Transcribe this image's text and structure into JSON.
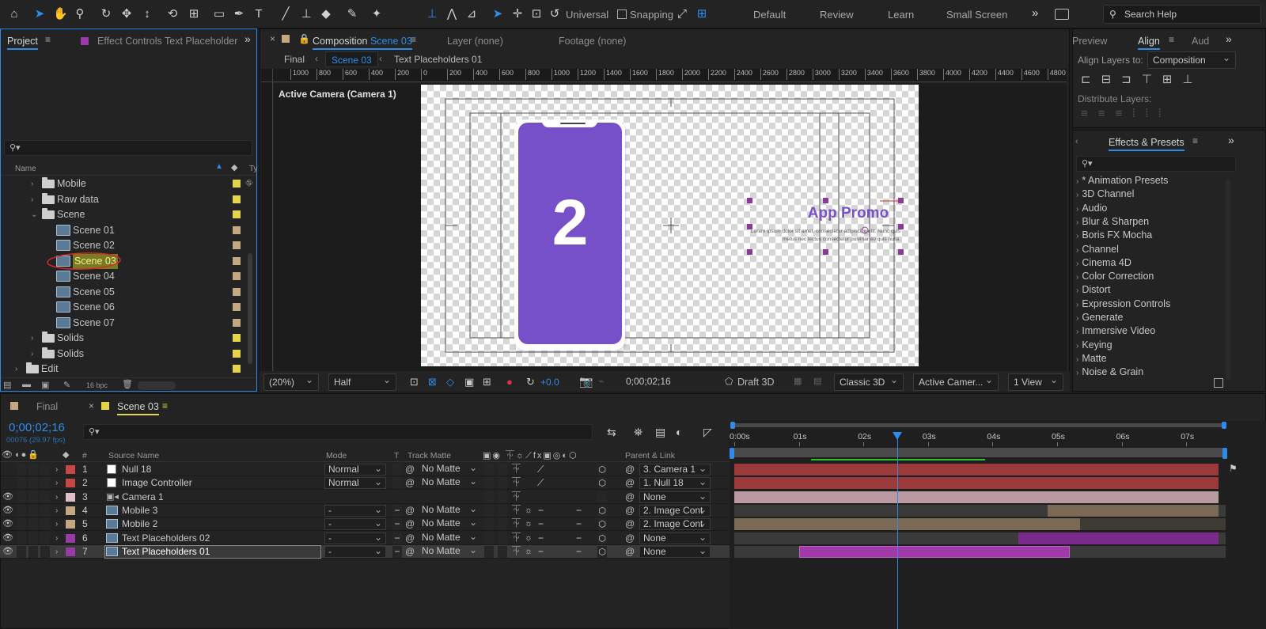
{
  "toolbar": {
    "tools": [
      "home-icon",
      "selection-icon",
      "hand-icon",
      "zoom-icon",
      "orbit-icon",
      "pan-icon",
      "dolly-icon",
      "rotate-icon",
      "pan-behind-icon",
      "rectangle-icon",
      "pen-icon",
      "text-icon",
      "brush-icon",
      "clone-stamp-icon",
      "eraser-icon",
      "roto-brush-icon",
      "puppet-icon"
    ],
    "universal_label": "Universal",
    "snapping_label": "Snapping",
    "workspaces": [
      "Default",
      "Review",
      "Learn",
      "Small Screen"
    ],
    "overflow": "»",
    "search_placeholder": "Search Help"
  },
  "project_panel": {
    "tab_project": "Project",
    "tab_effect_controls": "Effect Controls Text Placeholder",
    "search_placeholder": "",
    "col_name": "Name",
    "col_type": "Ty",
    "items": [
      {
        "label": "Mobile",
        "kind": "folder",
        "depth": 1,
        "expanded": false,
        "color": "#e5d34a"
      },
      {
        "label": "Raw data",
        "kind": "folder",
        "depth": 1,
        "expanded": false,
        "color": "#e5d34a"
      },
      {
        "label": "Scene",
        "kind": "folder",
        "depth": 1,
        "expanded": true,
        "color": "#e5d34a"
      },
      {
        "label": "Scene 01",
        "kind": "comp",
        "depth": 2,
        "color": "#c4a882"
      },
      {
        "label": "Scene 02",
        "kind": "comp",
        "depth": 2,
        "color": "#c4a882"
      },
      {
        "label": "Scene 03",
        "kind": "comp",
        "depth": 2,
        "color": "#c4a882",
        "highlighted": true
      },
      {
        "label": "Scene 04",
        "kind": "comp",
        "depth": 2,
        "color": "#c4a882"
      },
      {
        "label": "Scene 05",
        "kind": "comp",
        "depth": 2,
        "color": "#c4a882"
      },
      {
        "label": "Scene 06",
        "kind": "comp",
        "depth": 2,
        "color": "#c4a882"
      },
      {
        "label": "Scene 07",
        "kind": "comp",
        "depth": 2,
        "color": "#c4a882"
      },
      {
        "label": "Solids",
        "kind": "folder",
        "depth": 1,
        "expanded": false,
        "color": "#e5d34a"
      },
      {
        "label": "Solids",
        "kind": "folder",
        "depth": 1,
        "expanded": false,
        "color": "#e5d34a"
      },
      {
        "label": "Edit",
        "kind": "folder",
        "depth": 0,
        "expanded": false,
        "color": "#e5d34a"
      }
    ],
    "bpc": "16 bpc"
  },
  "composition_panel": {
    "tab_prefix": "Composition",
    "tab_comp": "Scene 03",
    "tab_layer": "Layer  (none)",
    "tab_footage": "Footage  (none)",
    "breadcrumb": [
      "Final",
      "Scene 03",
      "Text Placeholders 01"
    ],
    "ruler_ticks": [
      "1000",
      "800",
      "600",
      "400",
      "200",
      "0",
      "200",
      "400",
      "600",
      "800",
      "1000",
      "1200",
      "1400",
      "1600",
      "1800",
      "2000",
      "2200",
      "2400",
      "2600",
      "2800",
      "3000",
      "3200",
      "3400",
      "3600",
      "3800",
      "4000",
      "4200",
      "4400",
      "4600",
      "4800"
    ],
    "camera_label": "Active Camera (Camera 1)",
    "phone_number": "2",
    "promo_title": "App Promo",
    "promo_body": "Lorem ipsum dolor sit amet, consectetur adipiscing elit. Nunc quis metus nec lectus consectetur pulvinar eu quis nulla.",
    "zoom": "(20%)",
    "resolution": "Half",
    "exposure": "+0.0",
    "timecode": "0;00;02;16",
    "draft3d": "Draft 3D",
    "renderer": "Classic 3D",
    "camera_view": "Active Camer...",
    "views": "1 View"
  },
  "align_panel": {
    "tabs": [
      "Preview",
      "Align",
      "Aud"
    ],
    "align_layers_to_label": "Align Layers to:",
    "align_layers_to_value": "Composition",
    "distribute_label": "Distribute Layers:"
  },
  "effects_panel": {
    "title": "Effects & Presets",
    "search_placeholder": "",
    "categories": [
      "* Animation Presets",
      "3D Channel",
      "Audio",
      "Blur & Sharpen",
      "Boris FX Mocha",
      "Channel",
      "Cinema 4D",
      "Color Correction",
      "Distort",
      "Expression Controls",
      "Generate",
      "Immersive Video",
      "Keying",
      "Matte",
      "Noise & Grain"
    ]
  },
  "timeline": {
    "tabs": [
      {
        "label": "Final",
        "color": "#c4a882"
      },
      {
        "label": "Scene 03",
        "color": "#e5d34a"
      }
    ],
    "timecode": "0;00;02;16",
    "frames": "00076 (29.97 fps)",
    "search_placeholder": "",
    "headers": {
      "source": "Source Name",
      "mode": "Mode",
      "t": "T",
      "matte": "Track Matte",
      "parent": "Parent & Link"
    },
    "time_marks": [
      "0:00s",
      "01s",
      "02s",
      "03s",
      "04s",
      "05s",
      "06s",
      "07s"
    ],
    "playhead_seconds": 2.53,
    "work_area_seconds": [
      0,
      7.5
    ],
    "layers": [
      {
        "num": "1",
        "name": "Null 18",
        "icon": "white",
        "label_color": "#c94646",
        "mode": "Normal",
        "matte": "No Matte",
        "parent": "3. Camera 1",
        "bar_color": "#9a3a3a",
        "bar_start": 0,
        "bar_end": 7.5,
        "visible": false
      },
      {
        "num": "2",
        "name": "Image Controller",
        "icon": "white",
        "label_color": "#c94646",
        "mode": "Normal",
        "matte": "No Matte",
        "parent": "1. Null 18",
        "bar_color": "#9a3a3a",
        "bar_start": 0,
        "bar_end": 7.5,
        "visible": false
      },
      {
        "num": "3",
        "name": "Camera 1",
        "icon": "camera",
        "label_color": "#e0c0c8",
        "mode": "",
        "matte": "",
        "parent": "None",
        "bar_color": "#b89aa0",
        "bar_start": 0,
        "bar_end": 7.5,
        "visible": true
      },
      {
        "num": "4",
        "name": "Mobile 3",
        "icon": "comp",
        "label_color": "#c4a882",
        "mode": "-",
        "matte": "No Matte",
        "parent": "2. Image Cont",
        "bar_color": "#7a6a55",
        "bar_start": 4.85,
        "bar_end": 7.5,
        "visible": true
      },
      {
        "num": "5",
        "name": "Mobile 2",
        "icon": "comp",
        "label_color": "#c4a882",
        "mode": "-",
        "matte": "No Matte",
        "parent": "2. Image Cont",
        "bar_color": "#7a6a55",
        "bar_start": 0,
        "bar_end": 5.35,
        "visible": true
      },
      {
        "num": "6",
        "name": "Text Placeholders 02",
        "icon": "comp",
        "label_color": "#9a3aa8",
        "mode": "-",
        "matte": "No Matte",
        "parent": "None",
        "bar_color": "#7a2a8a",
        "bar_start": 4.4,
        "bar_end": 7.5,
        "visible": true
      },
      {
        "num": "7",
        "name": "Text Placeholders 01",
        "icon": "comp",
        "label_color": "#9a3aa8",
        "mode": "-",
        "matte": "No Matte",
        "parent": "None",
        "bar_color": "#a03aa8",
        "bar_start": 1.0,
        "bar_end": 5.2,
        "visible": true,
        "selected": true
      }
    ]
  }
}
